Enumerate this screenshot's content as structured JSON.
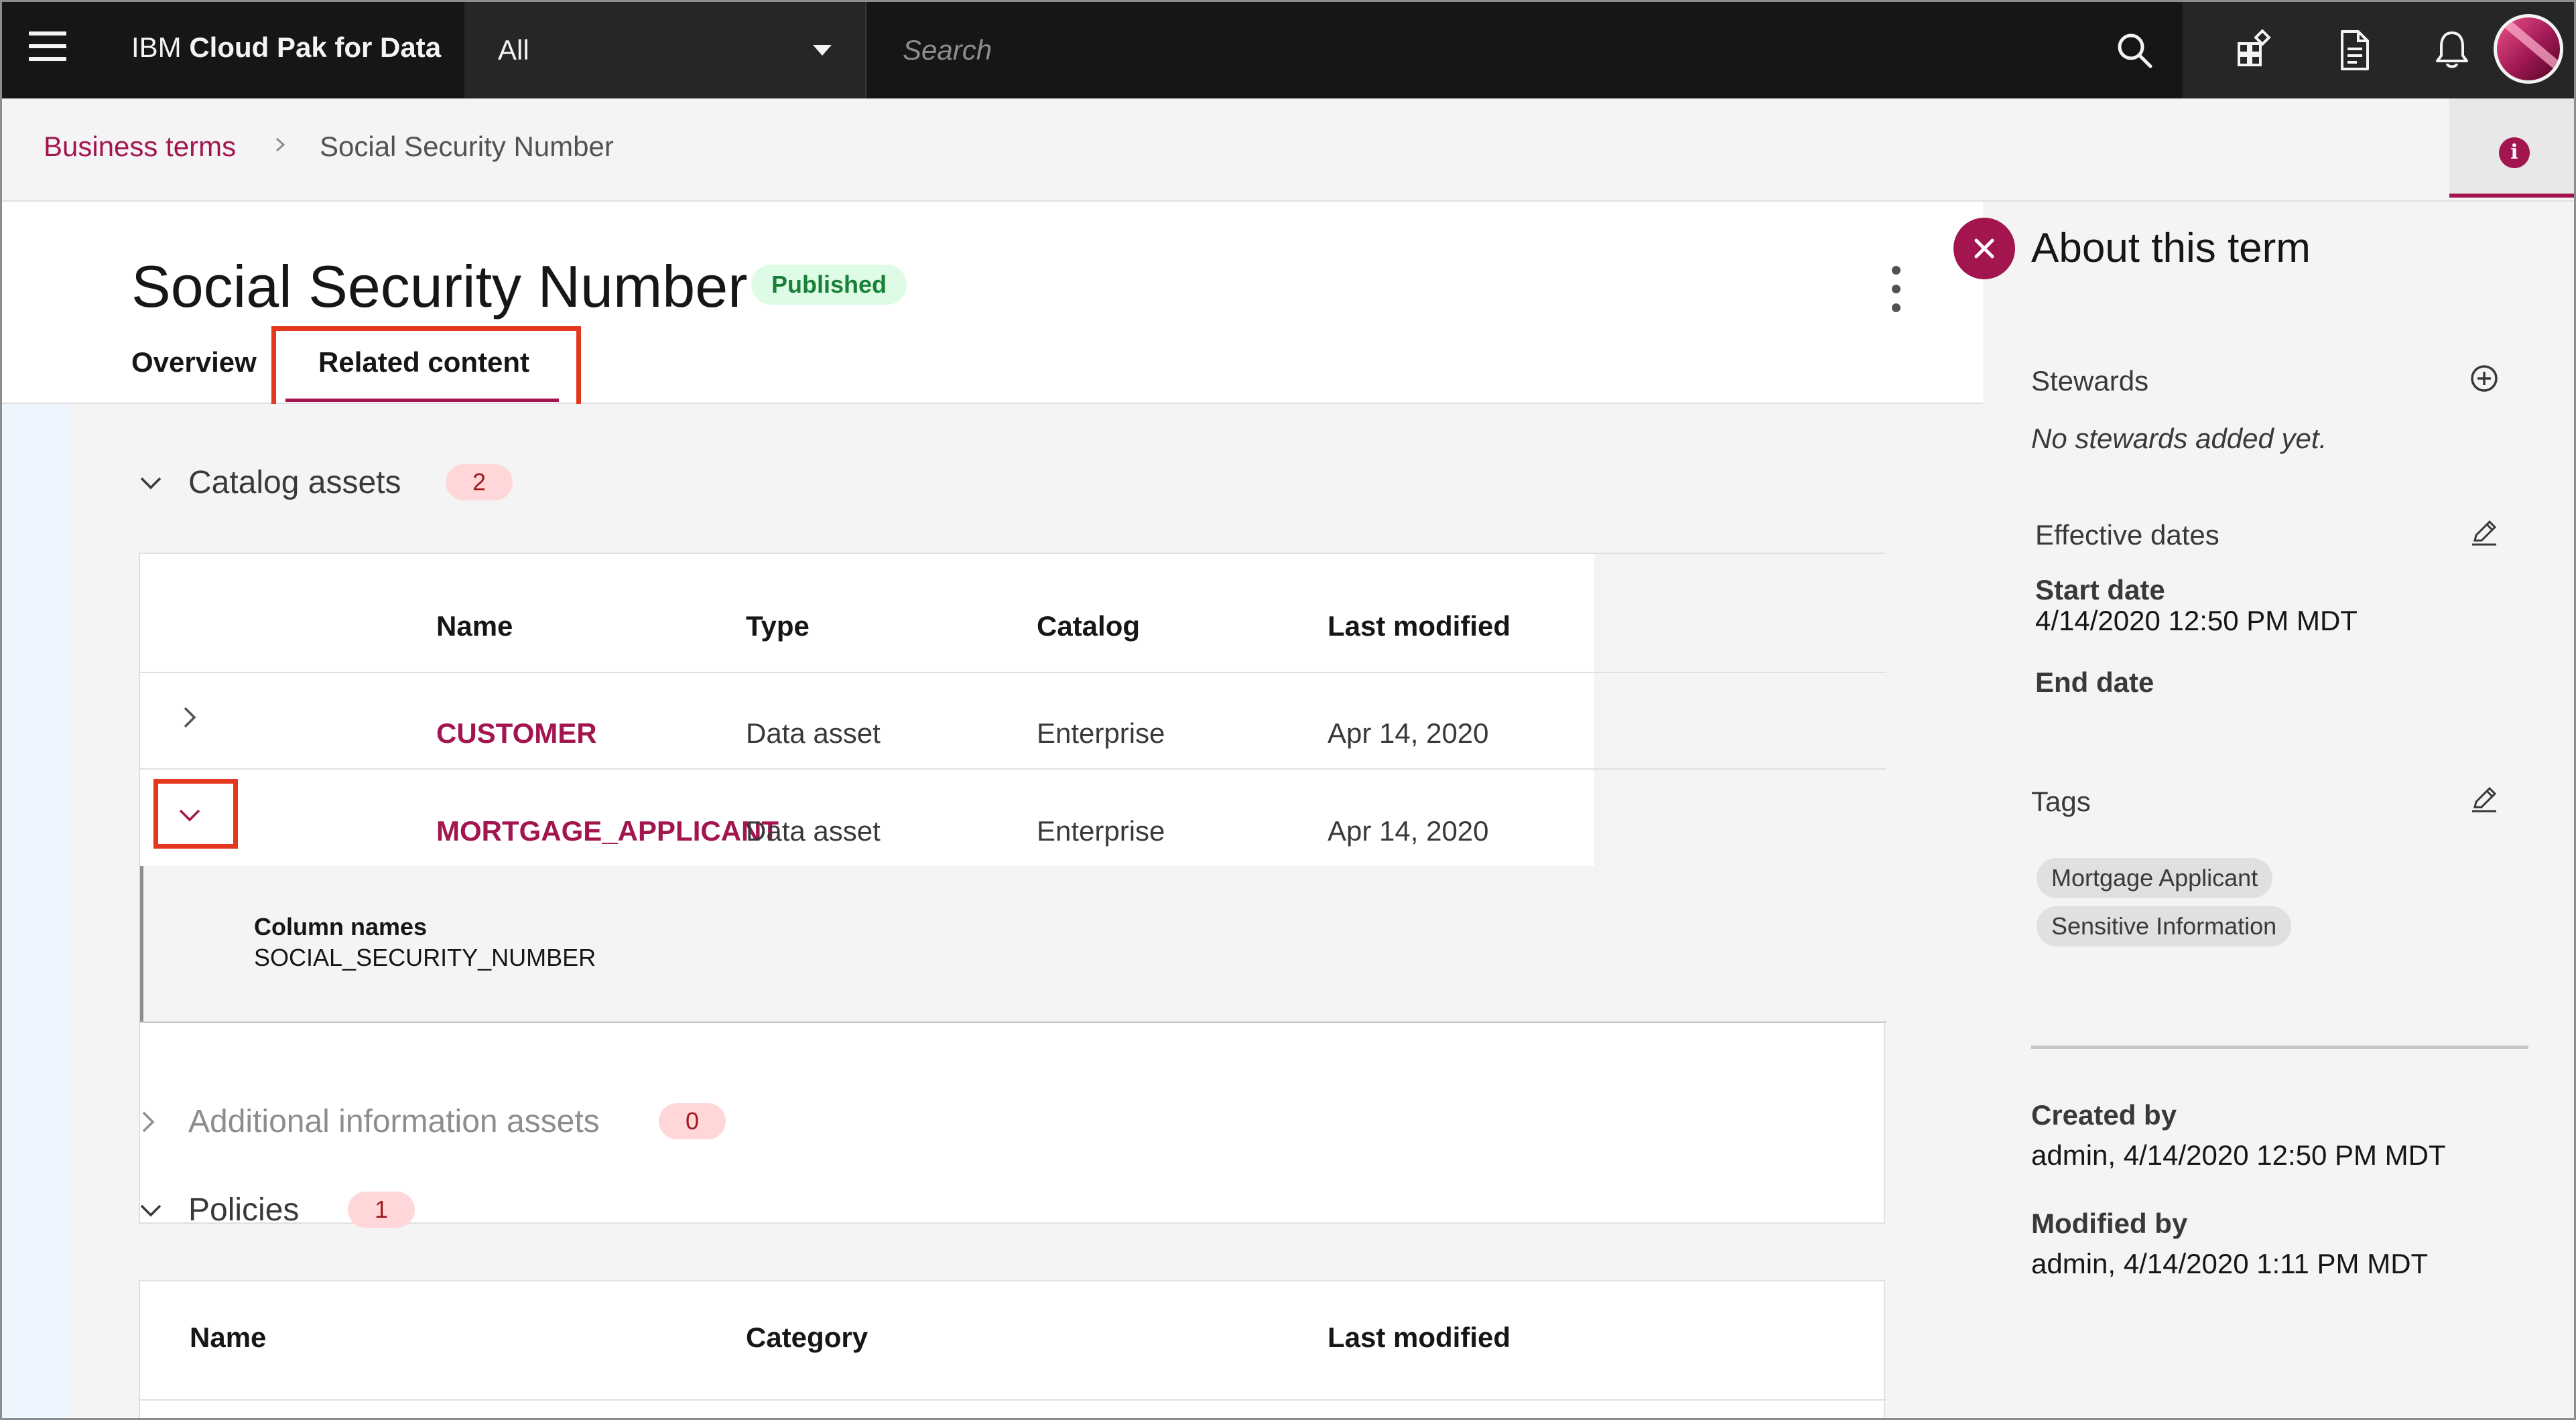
{
  "header": {
    "brand_prefix": "IBM",
    "brand_name": "Cloud Pak for Data",
    "scope_selected": "All",
    "search_placeholder": "Search"
  },
  "breadcrumb": {
    "parent": "Business terms",
    "current": "Social Security Number"
  },
  "term": {
    "title": "Social Security Number",
    "status": "Published",
    "tabs": [
      "Overview",
      "Related content"
    ],
    "active_tab": "Related content"
  },
  "catalog_assets": {
    "label": "Catalog assets",
    "count": "2",
    "columns": [
      "Name",
      "Type",
      "Catalog",
      "Last modified"
    ],
    "rows": [
      {
        "name": "CUSTOMER",
        "type": "Data asset",
        "catalog": "Enterprise",
        "modified": "Apr 14, 2020",
        "expanded": false
      },
      {
        "name": "MORTGAGE_APPLICANT",
        "type": "Data asset",
        "catalog": "Enterprise",
        "modified": "Apr 14, 2020",
        "expanded": true
      }
    ],
    "expanded_detail": {
      "label": "Column names",
      "value": "SOCIAL_SECURITY_NUMBER"
    }
  },
  "additional_assets": {
    "label": "Additional information assets",
    "count": "0"
  },
  "policies": {
    "label": "Policies",
    "count": "1",
    "columns": [
      "Name",
      "Category",
      "Last modified"
    ]
  },
  "side_panel": {
    "title": "About this term",
    "stewards_label": "Stewards",
    "stewards_empty": "No stewards added yet.",
    "effective_dates_label": "Effective dates",
    "start_date_label": "Start date",
    "start_date_value": "4/14/2020 12:50 PM MDT",
    "end_date_label": "End date",
    "tags_label": "Tags",
    "tags": [
      "Mortgage Applicant",
      "Sensitive Information"
    ],
    "created_by_label": "Created by",
    "created_by_value": "admin, 4/14/2020 12:50 PM MDT",
    "modified_by_label": "Modified by",
    "modified_by_value": "admin, 4/14/2020 1:11 PM MDT"
  },
  "colors": {
    "accent": "#a2154f",
    "highlight_box": "#e3371e",
    "published_bg": "#defbe6",
    "published_text": "#198038",
    "count_bg": "#ffd7d9"
  },
  "icons": [
    "menu-icon",
    "chevron-down-icon",
    "search-icon",
    "app-switcher-icon",
    "document-icon",
    "notification-icon",
    "avatar",
    "chevron-right-icon",
    "info-icon",
    "overflow-menu-icon",
    "close-icon",
    "add-icon",
    "edit-icon"
  ]
}
